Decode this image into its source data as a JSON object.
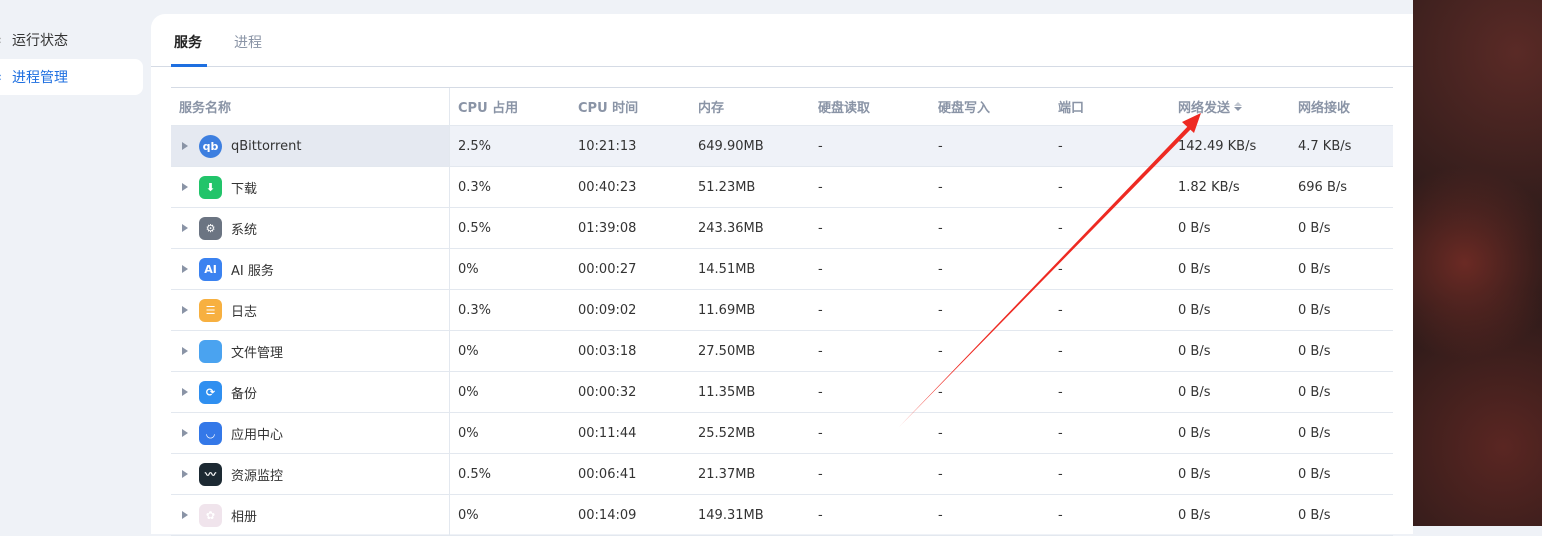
{
  "sidebar": {
    "items": [
      {
        "label": "运行状态",
        "active": false
      },
      {
        "label": "进程管理",
        "active": true
      }
    ]
  },
  "tabs": [
    {
      "label": "服务",
      "active": true
    },
    {
      "label": "进程",
      "active": false
    }
  ],
  "table": {
    "headers": [
      "服务名称",
      "CPU 占用",
      "CPU 时间",
      "内存",
      "硬盘读取",
      "硬盘写入",
      "端口",
      "网络发送",
      "网络接收"
    ],
    "sorted_column": "网络发送",
    "rows": [
      {
        "icon": "qbittorrent-icon",
        "icon_text": "qb",
        "color": "#3d7fe0",
        "cells": [
          "qBittorrent",
          "2.5%",
          "10:21:13",
          "649.90MB",
          "-",
          "-",
          "-",
          "142.49 KB/s",
          "4.7 KB/s"
        ]
      },
      {
        "icon": "download-icon",
        "icon_text": "⬇",
        "color": "#22c46a",
        "cells": [
          "下载",
          "0.3%",
          "00:40:23",
          "51.23MB",
          "-",
          "-",
          "-",
          "1.82 KB/s",
          "696 B/s"
        ]
      },
      {
        "icon": "system-gear-icon",
        "icon_text": "⚙",
        "color": "#6b7482",
        "cells": [
          "系统",
          "0.5%",
          "01:39:08",
          "243.36MB",
          "-",
          "-",
          "-",
          "0 B/s",
          "0 B/s"
        ]
      },
      {
        "icon": "ai-service-icon",
        "icon_text": "AI",
        "color": "#3b82f0",
        "cells": [
          "AI 服务",
          "0%",
          "00:00:27",
          "14.51MB",
          "-",
          "-",
          "-",
          "0 B/s",
          "0 B/s"
        ]
      },
      {
        "icon": "log-icon",
        "icon_text": "☰",
        "color": "#f7b040",
        "cells": [
          "日志",
          "0.3%",
          "00:09:02",
          "11.69MB",
          "-",
          "-",
          "-",
          "0 B/s",
          "0 B/s"
        ]
      },
      {
        "icon": "folder-icon",
        "icon_text": "",
        "color": "#4aa3f0",
        "cells": [
          "文件管理",
          "0%",
          "00:03:18",
          "27.50MB",
          "-",
          "-",
          "-",
          "0 B/s",
          "0 B/s"
        ]
      },
      {
        "icon": "backup-icon",
        "icon_text": "⟳",
        "color": "#2f8ff0",
        "cells": [
          "备份",
          "0%",
          "00:00:32",
          "11.35MB",
          "-",
          "-",
          "-",
          "0 B/s",
          "0 B/s"
        ]
      },
      {
        "icon": "app-store-icon",
        "icon_text": "◡",
        "color": "#3478e8",
        "cells": [
          "应用中心",
          "0%",
          "00:11:44",
          "25.52MB",
          "-",
          "-",
          "-",
          "0 B/s",
          "0 B/s"
        ]
      },
      {
        "icon": "resource-monitor-icon",
        "icon_text": "〰",
        "color": "#1d2a33",
        "cells": [
          "资源监控",
          "0.5%",
          "00:06:41",
          "21.37MB",
          "-",
          "-",
          "-",
          "0 B/s",
          "0 B/s"
        ]
      },
      {
        "icon": "photos-icon",
        "icon_text": "✿",
        "color": "#f0e4ec",
        "cells": [
          "相册",
          "0%",
          "00:14:09",
          "149.31MB",
          "-",
          "-",
          "-",
          "0 B/s",
          "0 B/s"
        ]
      }
    ]
  },
  "annotation_color": "#ee2a22"
}
